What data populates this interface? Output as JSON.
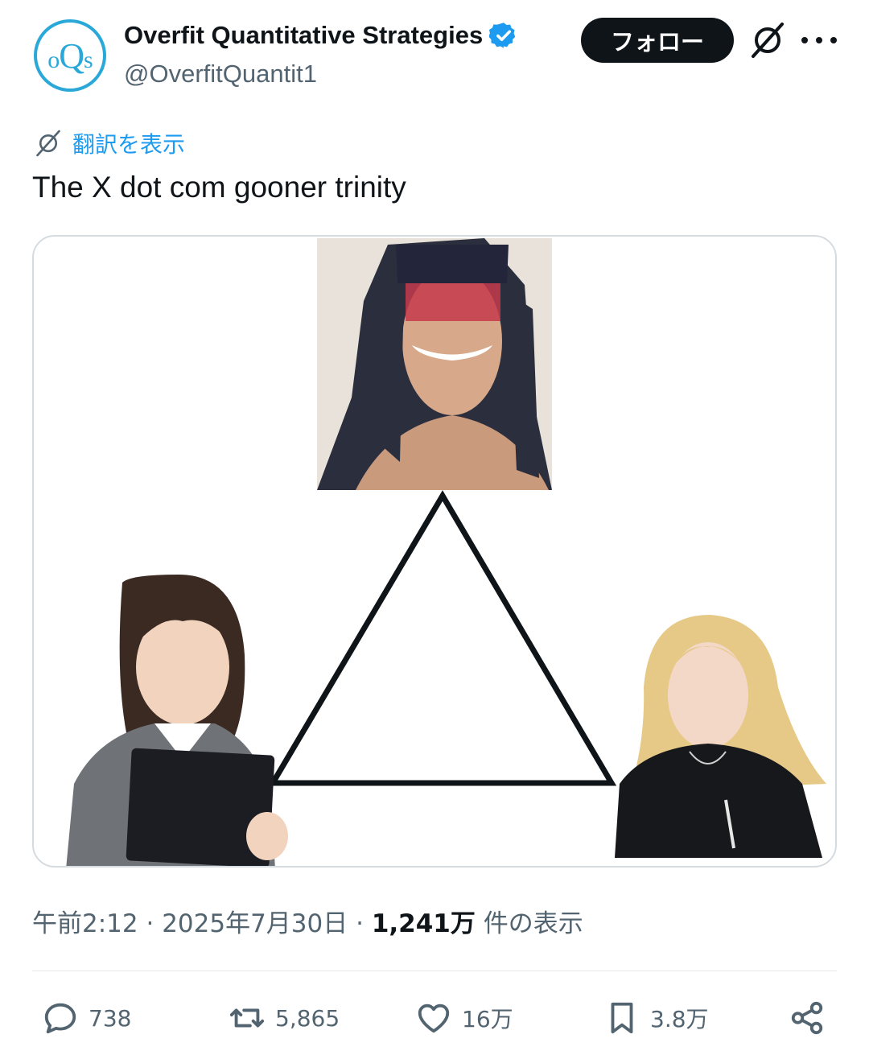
{
  "author": {
    "avatar_text_small_left": "o",
    "avatar_text_big": "Q",
    "avatar_text_small_right": "s",
    "display_name": "Overfit Quantitative Strategies",
    "handle": "@OverfitQuantit1",
    "verified": true
  },
  "header": {
    "follow_label": "フォロー",
    "grok_icon": "grok-icon",
    "more_icon": "more-dots-icon"
  },
  "translate": {
    "label": "翻訳を表示"
  },
  "post": {
    "text": "The X dot com gooner trinity"
  },
  "media": {
    "description_icon": "triangle-with-three-portraits"
  },
  "meta": {
    "time": "午前2:12",
    "separator": " · ",
    "date": "2025年7月30日",
    "views_count": "1,241万",
    "views_label": " 件の表示"
  },
  "actions": {
    "reply_count": "738",
    "retweet_count": "5,865",
    "like_count": "16万",
    "bookmark_count": "3.8万"
  },
  "colors": {
    "accent": "#1d9bf0",
    "text": "#0f1419",
    "muted": "#536471",
    "avatar": "#2aa8d8"
  }
}
